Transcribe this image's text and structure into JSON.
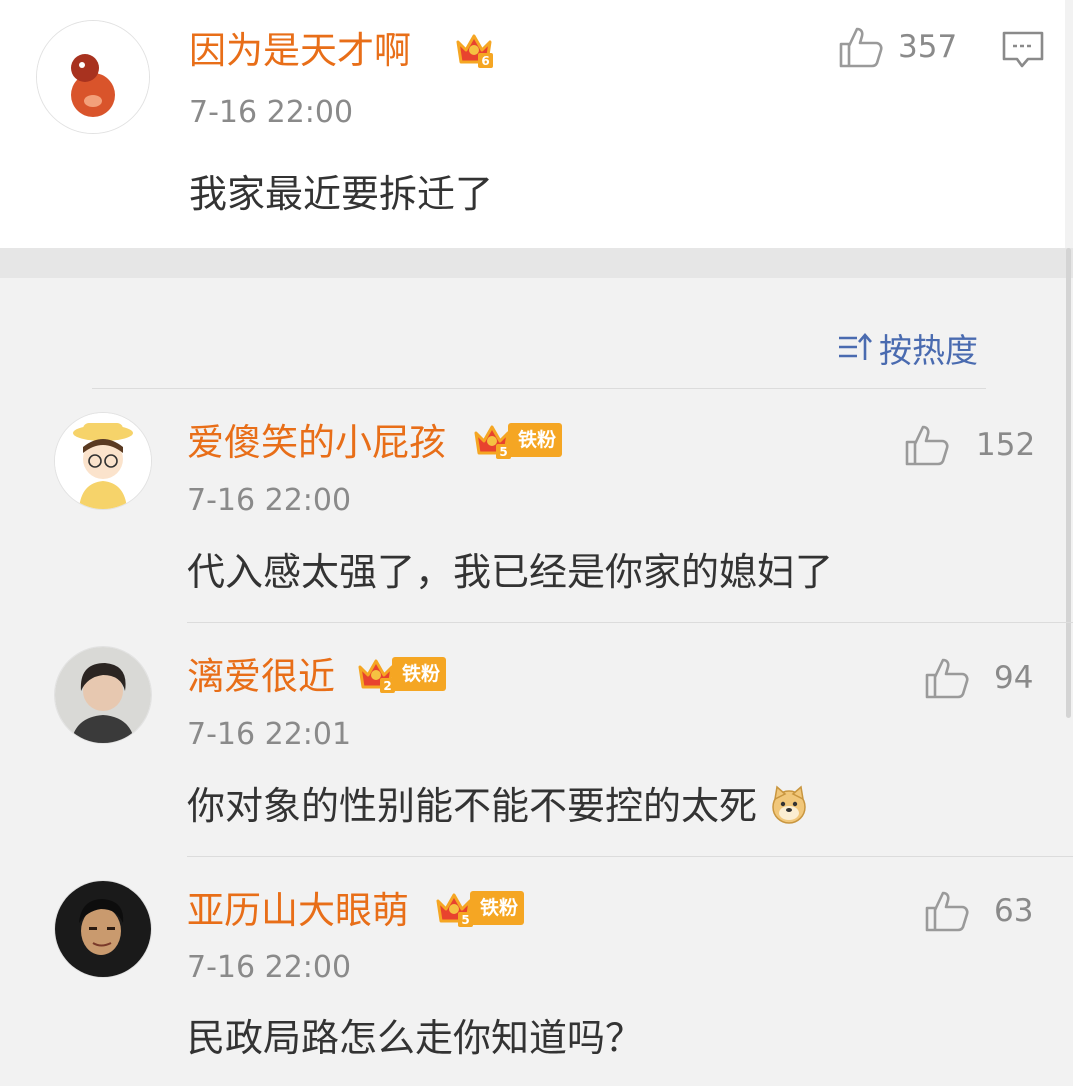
{
  "main_post": {
    "username": "因为是天才啊",
    "level": "6",
    "timestamp": "7-16 22:00",
    "content": "我家最近要拆迁了",
    "likes": "357"
  },
  "sort": {
    "label": "按热度"
  },
  "comments": [
    {
      "username": "爱傻笑的小屁孩",
      "level": "5",
      "fan_badge": "铁粉",
      "timestamp": "7-16 22:00",
      "content": "代入感太强了，我已经是你家的媳妇了",
      "likes": "152"
    },
    {
      "username": "漓爱很近",
      "level": "2",
      "fan_badge": "铁粉",
      "timestamp": "7-16 22:01",
      "content": "你对象的性别能不能不要控的太死",
      "likes": "94"
    },
    {
      "username": "亚历山大眼萌",
      "level": "5",
      "fan_badge": "铁粉",
      "timestamp": "7-16 22:00",
      "content": "民政局路怎么走你知道吗？",
      "likes": "63"
    }
  ],
  "colors": {
    "username": "#e86e18",
    "meta": "#8a8a8a",
    "text": "#333333",
    "badge": "#f5a623",
    "sort": "#4a6bb0"
  }
}
